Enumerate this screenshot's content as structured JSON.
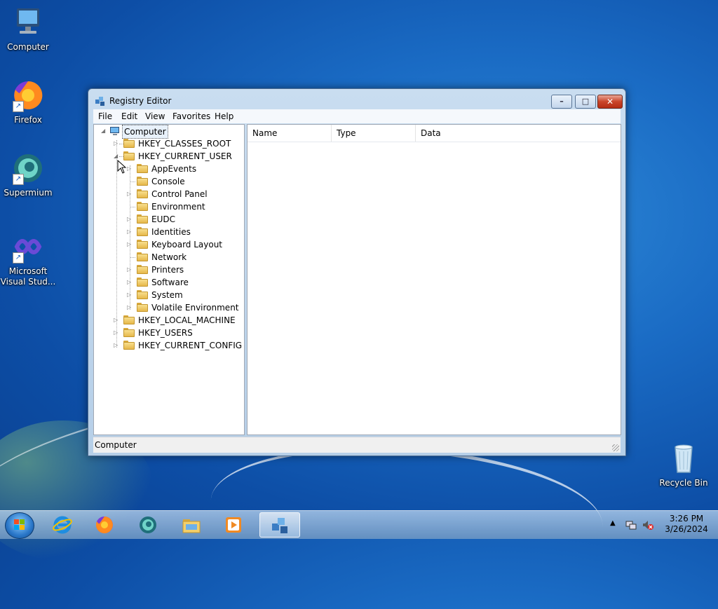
{
  "desktop": {
    "icons": [
      {
        "label": "Computer"
      },
      {
        "label": "Firefox"
      },
      {
        "label": "Supermium"
      },
      {
        "label": "Microsoft Visual Stud..."
      },
      {
        "label": "Recycle Bin"
      }
    ]
  },
  "window": {
    "title": "Registry Editor",
    "menu": [
      "File",
      "Edit",
      "View",
      "Favorites",
      "Help"
    ],
    "tree": {
      "root": "Computer",
      "hives": [
        "HKEY_CLASSES_ROOT",
        "HKEY_CURRENT_USER",
        "HKEY_LOCAL_MACHINE",
        "HKEY_USERS",
        "HKEY_CURRENT_CONFIG"
      ],
      "current_user_children": [
        "AppEvents",
        "Console",
        "Control Panel",
        "Environment",
        "EUDC",
        "Identities",
        "Keyboard Layout",
        "Network",
        "Printers",
        "Software",
        "System",
        "Volatile Environment"
      ]
    },
    "columns": [
      "Name",
      "Type",
      "Data"
    ],
    "status": "Computer"
  },
  "taskbar": {
    "clock_time": "3:26 PM",
    "clock_date": "3/26/2024",
    "apps": [
      "internet-explorer",
      "firefox",
      "supermium",
      "file-explorer",
      "media-player",
      "registry-editor"
    ]
  },
  "colors": {
    "accent": "#1a6bc4",
    "window_frame": "#b6cfe8",
    "close": "#c9452a"
  }
}
